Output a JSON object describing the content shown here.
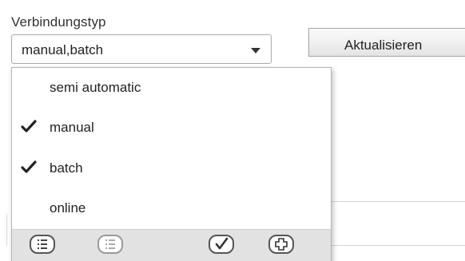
{
  "field": {
    "label": "Verbindungstyp",
    "selected_value": "manual,batch"
  },
  "toolbar": {
    "refresh_label": "Aktualisieren"
  },
  "dropdown": {
    "options": [
      {
        "label": "semi automatic",
        "checked": false
      },
      {
        "label": "manual",
        "checked": true
      },
      {
        "label": "batch",
        "checked": true
      },
      {
        "label": "online",
        "checked": false
      }
    ],
    "actions": [
      {
        "icon": "select-all-list-icon",
        "enabled": true
      },
      {
        "icon": "deselect-all-list-icon",
        "enabled": false
      },
      {
        "icon": "confirm-check-icon",
        "enabled": true
      },
      {
        "icon": "add-plus-icon",
        "enabled": true
      }
    ]
  },
  "colors": {
    "check": "#222222",
    "toolbar_bg": "#e2e2e2",
    "border": "#a9a9a9"
  }
}
